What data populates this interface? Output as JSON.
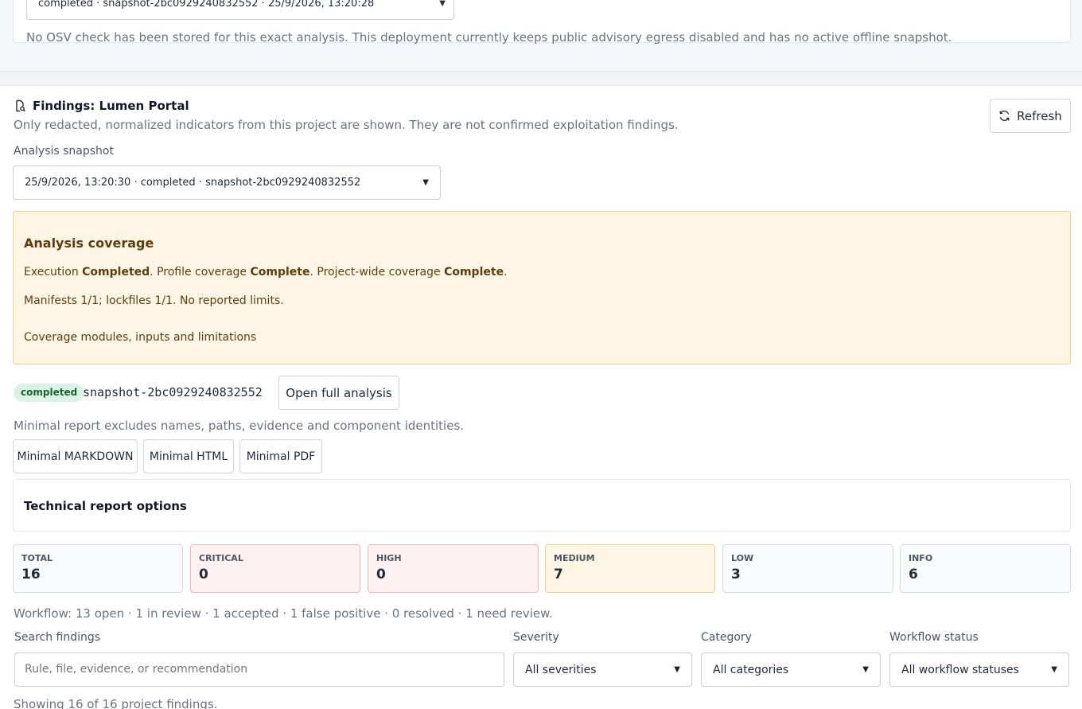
{
  "osv": {
    "selected_analysis": "completed · snapshot-2bc0929240832552 · 25/9/2026, 13:20:28",
    "note": "No OSV check has been stored for this exact analysis. This deployment currently keeps public advisory egress disabled and has no active offline snapshot."
  },
  "findings": {
    "title": "Findings: Lumen Portal",
    "subtitle": "Only redacted, normalized indicators from this project are shown. They are not confirmed exploitation findings.",
    "refresh_label": "Refresh",
    "snapshot_label": "Analysis snapshot",
    "snapshot_selected": "25/9/2026, 13:20:30 · completed · snapshot-2bc0929240832552"
  },
  "coverage": {
    "title": "Analysis coverage",
    "execution_prefix": "Execution ",
    "execution_value": "Completed",
    "profile_prefix": ". Profile coverage ",
    "profile_value": "Complete",
    "project_prefix": ". Project-wide coverage ",
    "project_value": "Complete",
    "project_suffix": ".",
    "manifests_line": "Manifests 1/1; lockfiles 1/1. No reported limits.",
    "details_summary": "Coverage modules, inputs and limitations"
  },
  "analysis": {
    "status_badge": "completed",
    "snapshot_id": "snapshot-2bc0929240832552",
    "open_full_label": "Open full analysis",
    "minimal_note": "Minimal report excludes names, paths, evidence and component identities.",
    "exports": [
      "Minimal MARKDOWN",
      "Minimal HTML",
      "Minimal PDF"
    ],
    "technical_options_title": "Technical report options"
  },
  "stats": [
    {
      "key": "TOTAL",
      "value": "16",
      "tone": "neutral"
    },
    {
      "key": "CRITICAL",
      "value": "0",
      "tone": "red"
    },
    {
      "key": "HIGH",
      "value": "0",
      "tone": "red"
    },
    {
      "key": "MEDIUM",
      "value": "7",
      "tone": "amber"
    },
    {
      "key": "LOW",
      "value": "3",
      "tone": "neutral"
    },
    {
      "key": "INFO",
      "value": "6",
      "tone": "neutral"
    }
  ],
  "workflow_note": "Workflow: 13 open · 1 in review · 1 accepted · 1 false positive · 0 resolved · 1 need review.",
  "filters": {
    "search_label": "Search findings",
    "search_placeholder": "Rule, file, evidence, or recommendation",
    "severity_label": "Severity",
    "severity_value": "All severities",
    "category_label": "Category",
    "category_value": "All categories",
    "workflow_label": "Workflow status",
    "workflow_value": "All workflow statuses"
  },
  "showing_note": "Showing 16 of 16 project findings.",
  "colors": {
    "accent_amber_bg": "#fef6e4",
    "accent_amber_border": "#f0cf8c",
    "danger_bg": "#fdf1f1",
    "success_bg": "#dcf2e4"
  }
}
